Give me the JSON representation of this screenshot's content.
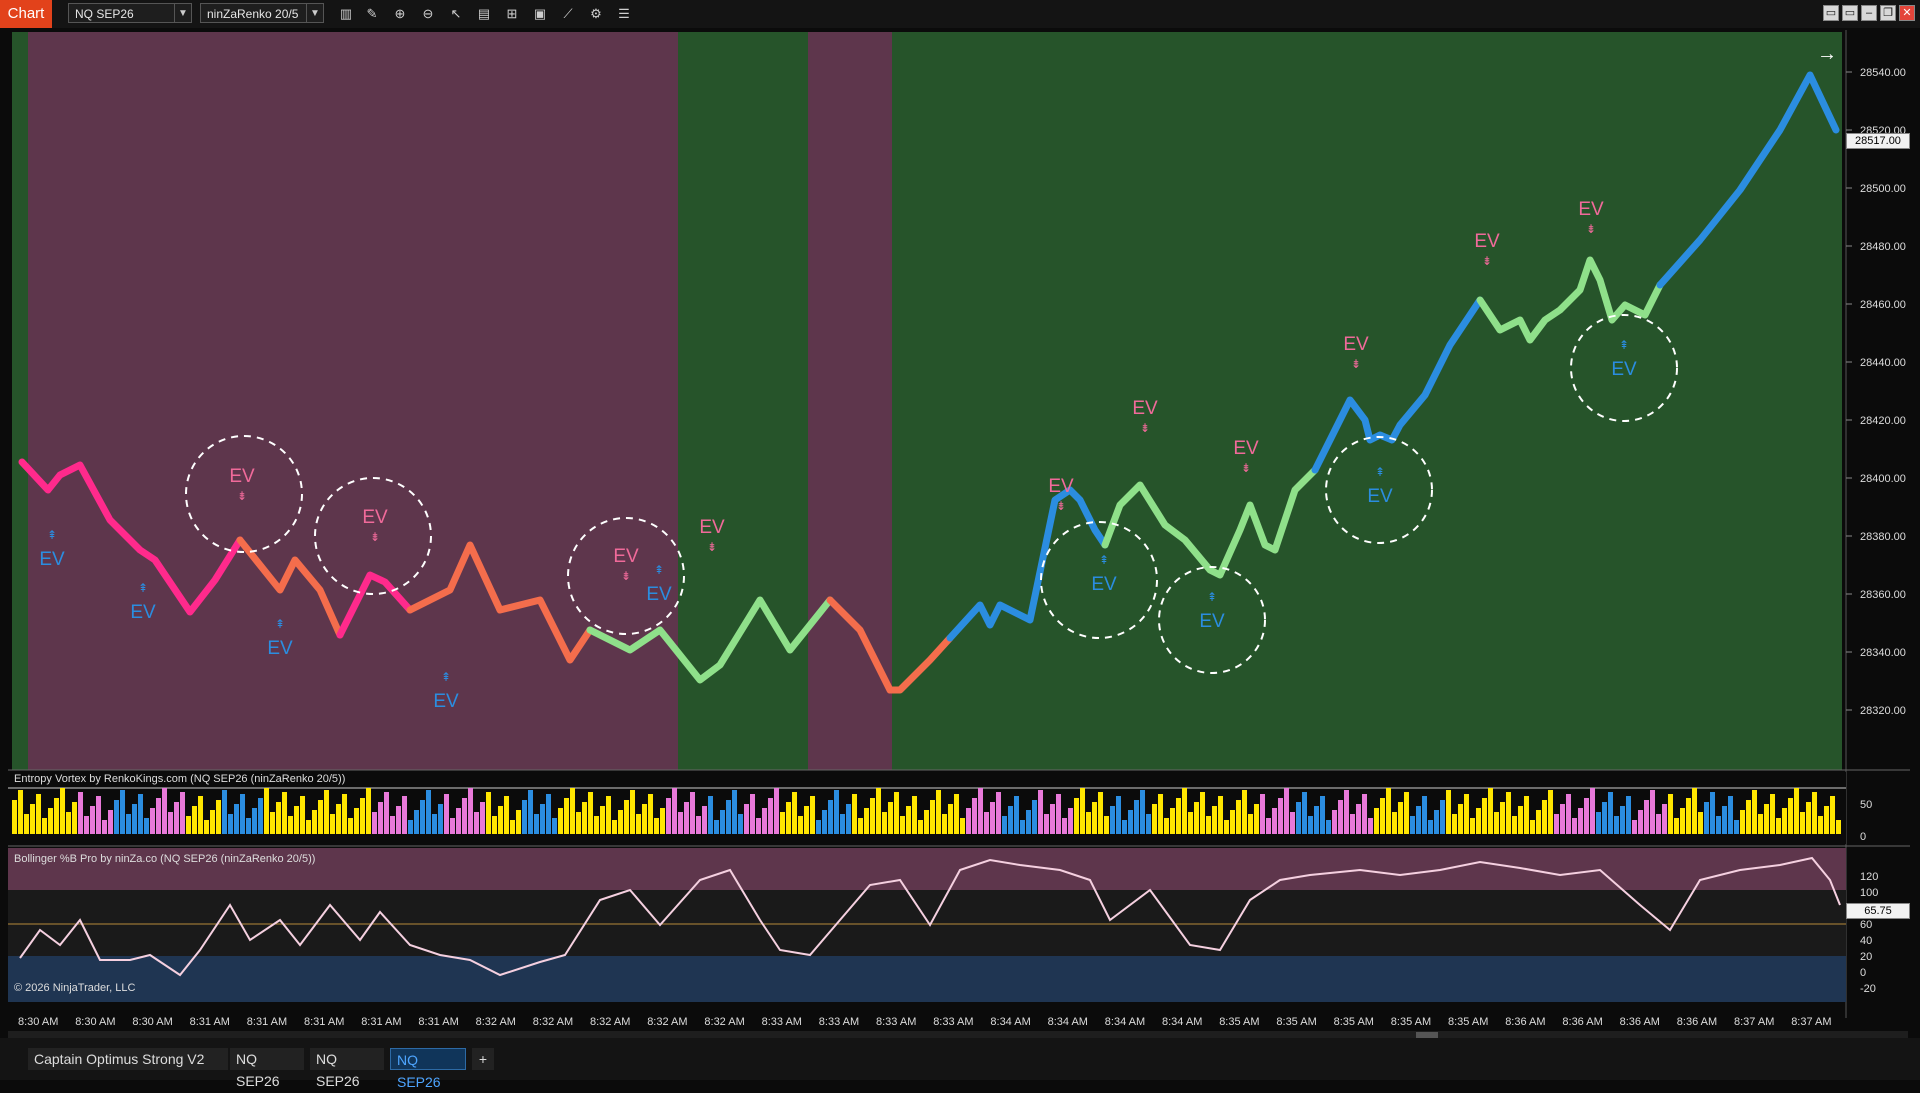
{
  "toolbar": {
    "chart_label": "Chart",
    "instrument": "NQ SEP26",
    "bar_type": "ninZaRenko 20/5"
  },
  "colors": {
    "bull_bg": "#26542a",
    "bear_bg": "#5e364c",
    "blue_bar": "#2b8de0",
    "pink_bar": "#ff2a8c",
    "orange_bar": "#f46d4c",
    "green_bar": "#8fe08a",
    "ev_pink": "#f06a9a",
    "ev_blue": "#2b8de0"
  },
  "price_panel": {
    "current_price": "28517.00",
    "axis_ticks": [
      "28540.00",
      "28520.00",
      "28500.00",
      "28480.00",
      "28460.00",
      "28440.00",
      "28420.00",
      "28400.00",
      "28380.00",
      "28360.00",
      "28340.00",
      "28320.00"
    ],
    "signal_text": "EV"
  },
  "entropy_panel": {
    "title": "Entropy Vortex by RenkoKings.com (NQ SEP26 (ninZaRenko 20/5))",
    "axis_ticks": [
      "50",
      "0"
    ]
  },
  "bollinger_panel": {
    "title": "Bollinger %B Pro by ninZa.co (NQ SEP26 (ninZaRenko 20/5))",
    "current_value": "65.75",
    "axis_ticks": [
      "120",
      "100",
      "80",
      "60",
      "40",
      "20",
      "0",
      "-20"
    ],
    "copyright": "© 2026 NinjaTrader, LLC"
  },
  "time_axis": [
    "8:30 AM",
    "8:30 AM",
    "8:30 AM",
    "8:31 AM",
    "8:31 AM",
    "8:31 AM",
    "8:31 AM",
    "8:31 AM",
    "8:32 AM",
    "8:32 AM",
    "8:32 AM",
    "8:32 AM",
    "8:32 AM",
    "8:33 AM",
    "8:33 AM",
    "8:33 AM",
    "8:33 AM",
    "8:34 AM",
    "8:34 AM",
    "8:34 AM",
    "8:34 AM",
    "8:35 AM",
    "8:35 AM",
    "8:35 AM",
    "8:35 AM",
    "8:35 AM",
    "8:36 AM",
    "8:36 AM",
    "8:36 AM",
    "8:36 AM",
    "8:37 AM",
    "8:37 AM"
  ],
  "bottom_tabs": [
    {
      "label": "Captain Optimus Strong V2"
    },
    {
      "label": "NQ SEP26"
    },
    {
      "label": "NQ SEP26"
    },
    {
      "label": "NQ SEP26"
    }
  ],
  "add_tab_label": "+"
}
